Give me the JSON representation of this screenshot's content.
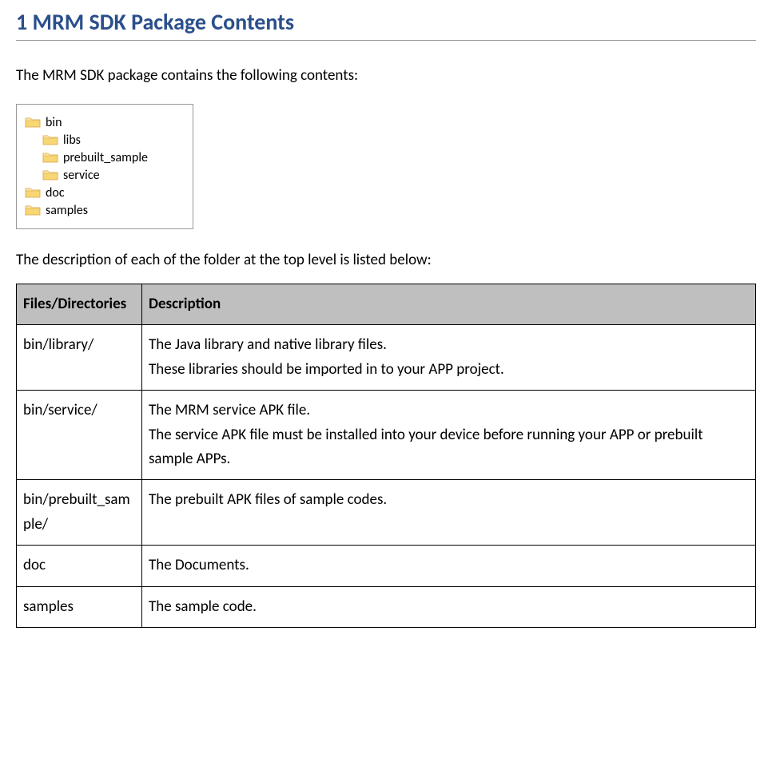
{
  "heading": "1 MRM SDK Package Contents",
  "intro": "The MRM SDK package contains the following contents:",
  "folders": {
    "top": [
      {
        "name": "bin",
        "indent": 0
      },
      {
        "name": "libs",
        "indent": 1
      },
      {
        "name": "prebuilt_sample",
        "indent": 1
      },
      {
        "name": "service",
        "indent": 1
      },
      {
        "name": "doc",
        "indent": 0
      },
      {
        "name": "samples",
        "indent": 0
      }
    ]
  },
  "description_intro": "The description of each of the folder at the top level is listed below:",
  "table": {
    "headers": {
      "col1": "Files/Directories",
      "col2": "Description"
    },
    "rows": [
      {
        "name": "bin/library/",
        "desc": "The Java library and native library files.\nThese libraries should be imported in to your APP project."
      },
      {
        "name": "bin/service/",
        "desc": "The MRM service APK file.\nThe service APK file must be installed into your device before running your APP or prebuilt sample APPs."
      },
      {
        "name": "bin/prebuilt_sample/",
        "desc": "The prebuilt APK files of sample codes."
      },
      {
        "name": "doc",
        "desc": "The Documents."
      },
      {
        "name": "samples",
        "desc": "The sample code."
      }
    ]
  }
}
